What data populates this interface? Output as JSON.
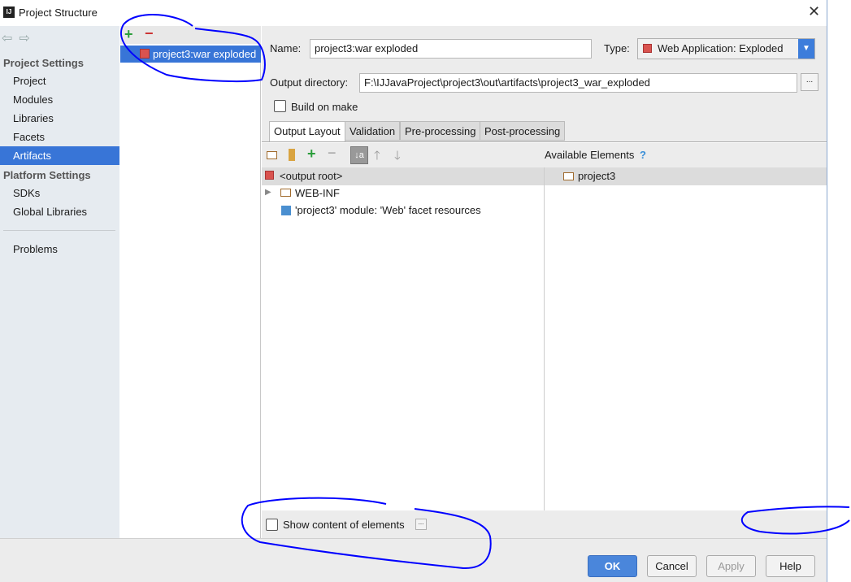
{
  "window": {
    "title": "Project Structure",
    "logo": "IJ"
  },
  "sidebar": {
    "project_settings": "Project Settings",
    "items": [
      "Project",
      "Modules",
      "Libraries",
      "Facets",
      "Artifacts"
    ],
    "platform_settings": "Platform Settings",
    "platform_items": [
      "SDKs",
      "Global Libraries"
    ],
    "problems": "Problems",
    "selected": "Artifacts"
  },
  "artifacts": {
    "list": [
      "project3:war exploded"
    ]
  },
  "form": {
    "name_label": "Name:",
    "name_value": "project3:war exploded",
    "type_label": "Type:",
    "type_value": "Web Application: Exploded",
    "output_label": "Output directory:",
    "output_value": "F:\\IJJavaProject\\project3\\out\\artifacts\\project3_war_exploded",
    "build_on_make": "Build on make",
    "browse": "..."
  },
  "tabs": [
    "Output Layout",
    "Validation",
    "Pre-processing",
    "Post-processing"
  ],
  "layout": {
    "root": "<output root>",
    "tree": [
      "WEB-INF",
      "'project3' module: 'Web' facet resources"
    ],
    "available_title": "Available Elements",
    "help": "?",
    "available": [
      "project3"
    ]
  },
  "footer": {
    "show_content": "Show content of elements",
    "more": "...",
    "buttons": {
      "ok": "OK",
      "cancel": "Cancel",
      "apply": "Apply",
      "help": "Help"
    }
  },
  "colors": {
    "selection": "#3875d7",
    "annotation": "#0000ff"
  }
}
